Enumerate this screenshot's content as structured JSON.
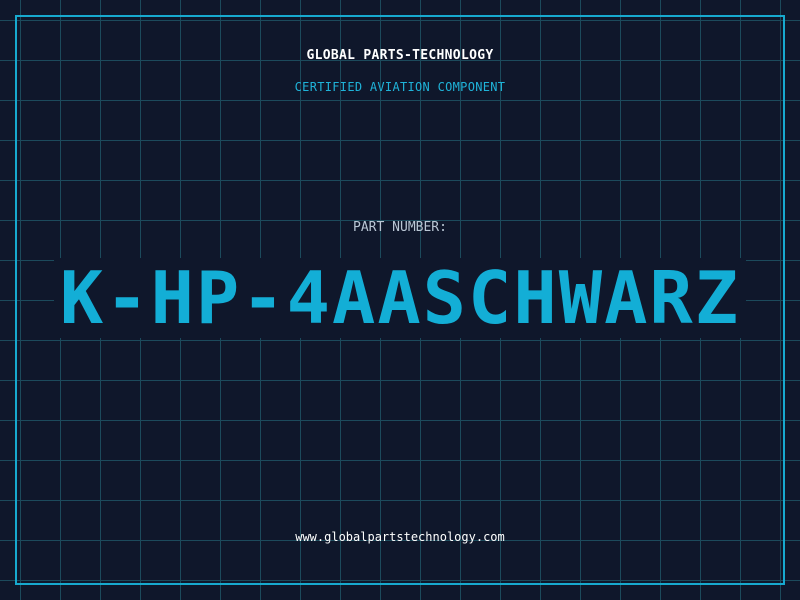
{
  "header": {
    "company": "GLOBAL PARTS-TECHNOLOGY",
    "subtitle": "CERTIFIED AVIATION COMPONENT"
  },
  "main": {
    "part_label": "PART NUMBER:",
    "part_number": "K-HP-4AASCHWARZ"
  },
  "footer": {
    "url": "www.globalpartstechnology.com"
  },
  "colors": {
    "background": "#0f172b",
    "grid": "#1c4a5c",
    "accent": "#17a9cf",
    "text": "#ffffff"
  }
}
